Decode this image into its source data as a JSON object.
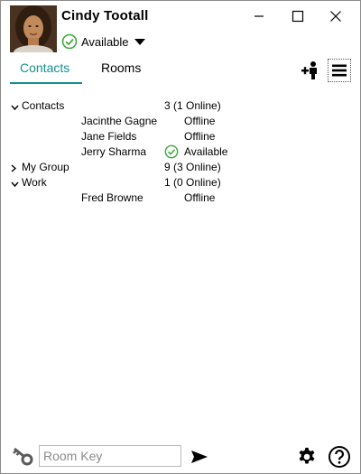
{
  "user": {
    "name": "Cindy Tootall",
    "status": "Available"
  },
  "tabs": [
    {
      "label": "Contacts",
      "active": true
    },
    {
      "label": "Rooms",
      "active": false
    }
  ],
  "tree": {
    "groups": [
      {
        "name": "Contacts",
        "expanded": true,
        "summary": "3 (1 Online)",
        "members": [
          {
            "name": "Jacinthe Gagne",
            "status": "Offline",
            "online": false
          },
          {
            "name": "Jane Fields",
            "status": "Offline",
            "online": false
          },
          {
            "name": "Jerry Sharma",
            "status": "Available",
            "online": true
          }
        ]
      },
      {
        "name": "My Group",
        "expanded": false,
        "summary": "9 (3 Online)",
        "members": []
      },
      {
        "name": "Work",
        "expanded": true,
        "summary": "1 (0 Online)",
        "members": [
          {
            "name": "Fred Browne",
            "status": "Offline",
            "online": false
          }
        ]
      }
    ]
  },
  "bottom": {
    "room_key_placeholder": "Room Key"
  },
  "icons": {
    "status": "check-circle-icon",
    "dropdown": "caret-down-icon",
    "minimize": "minimize-icon",
    "maximize": "maximize-icon",
    "close": "close-icon",
    "add_contact": "add-person-icon",
    "menu": "hamburger-menu-icon",
    "key": "key-icon",
    "send": "send-icon",
    "settings": "gear-icon",
    "help": "help-icon"
  },
  "colors": {
    "accent": "#14908f",
    "available_green": "#3ea83e"
  }
}
